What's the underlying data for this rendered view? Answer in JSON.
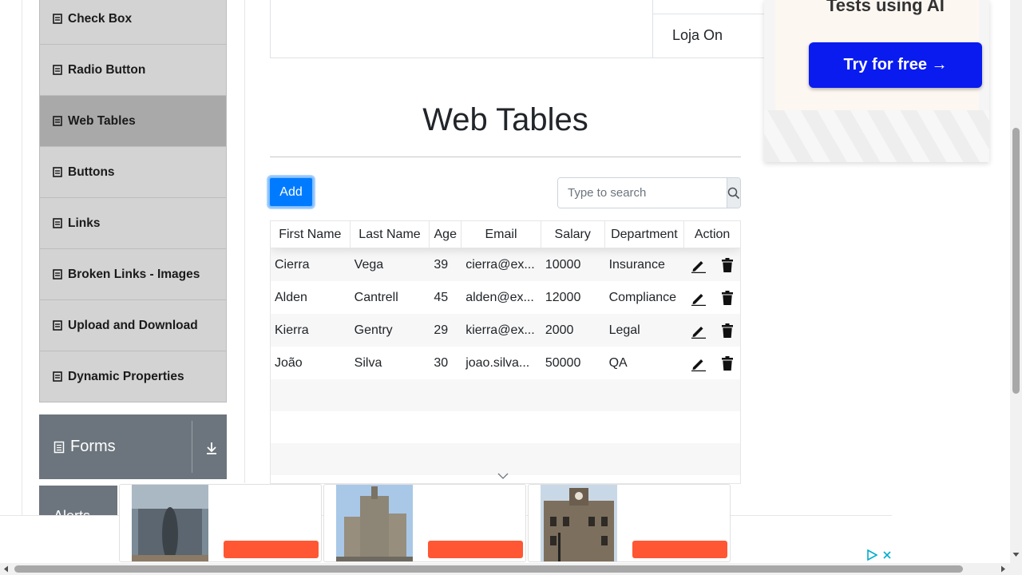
{
  "sidebar": {
    "items": [
      {
        "label": "Check Box",
        "active": false
      },
      {
        "label": "Radio Button",
        "active": false
      },
      {
        "label": "Web Tables",
        "active": true
      },
      {
        "label": "Buttons",
        "active": false
      },
      {
        "label": "Links",
        "active": false
      },
      {
        "label": "Broken Links - Images",
        "active": false
      },
      {
        "label": "Upload and Download",
        "active": false
      },
      {
        "label": "Dynamic Properties",
        "active": false
      }
    ],
    "forms_group": {
      "label": "Forms"
    },
    "alerts_group": {
      "label": "Alerts"
    }
  },
  "top_frame": {
    "cell_text": "Loja On"
  },
  "main": {
    "title": "Web Tables",
    "add_button": "Add",
    "search": {
      "placeholder": "Type to search",
      "value": ""
    }
  },
  "table": {
    "columns": [
      "First Name",
      "Last Name",
      "Age",
      "Email",
      "Salary",
      "Department",
      "Action"
    ],
    "rows": [
      {
        "first": "Cierra",
        "last": "Vega",
        "age": "39",
        "email": "cierra@ex...",
        "salary": "10000",
        "department": "Insurance"
      },
      {
        "first": "Alden",
        "last": "Cantrell",
        "age": "45",
        "email": "alden@ex...",
        "salary": "12000",
        "department": "Compliance"
      },
      {
        "first": "Kierra",
        "last": "Gentry",
        "age": "29",
        "email": "kierra@ex...",
        "salary": "2000",
        "department": "Legal"
      },
      {
        "first": "João",
        "last": "Silva",
        "age": "30",
        "email": "joao.silva...",
        "salary": "50000",
        "department": "QA"
      }
    ]
  },
  "ad": {
    "headline": "Tests using AI",
    "cta": "Try for free →"
  },
  "colors": {
    "accent": "#007bff",
    "ad_button": "#0a1bf0",
    "ad_cta": "#ff5733",
    "sidebar_item": "#d3d3d3",
    "sidebar_active": "#a9a9a9",
    "group_header": "#6c757d"
  },
  "icons": [
    "list-icon",
    "form-icon",
    "download-icon",
    "search-icon",
    "edit-icon",
    "delete-icon",
    "chevron-down-icon",
    "adchoices-icon",
    "close-icon"
  ]
}
